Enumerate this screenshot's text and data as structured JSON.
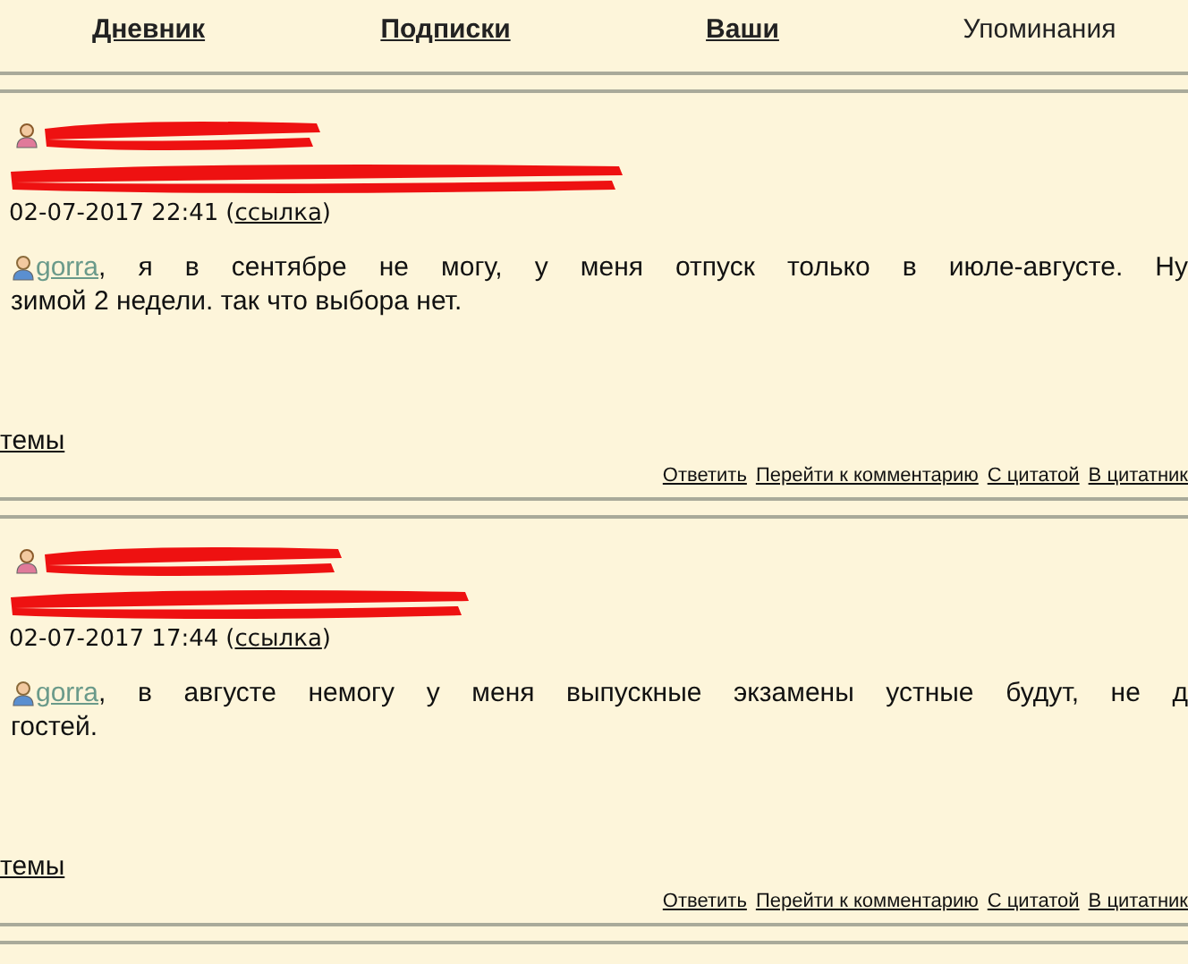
{
  "nav": [
    {
      "label": "Дневник",
      "selected": false
    },
    {
      "label": "Подписки",
      "selected": false
    },
    {
      "label": "Ваши",
      "selected": false
    },
    {
      "label": "Упоминания",
      "selected": true
    }
  ],
  "comments": [
    {
      "datetime": "02-07-2017 22:41",
      "open_bracket": "(",
      "link_label": "ссылка",
      "close_bracket": ")",
      "mention": "gorra",
      "first_line": ", я в сентябре не могу, у меня отпуск только в июле-августе. Ну",
      "more_lines": [
        "зимой 2 недели. так что выбора нет."
      ],
      "topic_link": "темы",
      "actions": [
        "Ответить",
        "Перейти к комментарию",
        "С цитатой",
        "В цитатник"
      ]
    },
    {
      "datetime": "02-07-2017 17:44",
      "open_bracket": "(",
      "link_label": "ссылка",
      "close_bracket": ")",
      "mention": "gorra",
      "first_line": ", в августе немогу у меня выпускные экзамены устные будут, не д",
      "more_lines": [
        "гостей."
      ],
      "topic_link": "темы",
      "actions": [
        "Ответить",
        "Перейти к комментарию",
        "С цитатой",
        "В цитатник"
      ]
    }
  ]
}
